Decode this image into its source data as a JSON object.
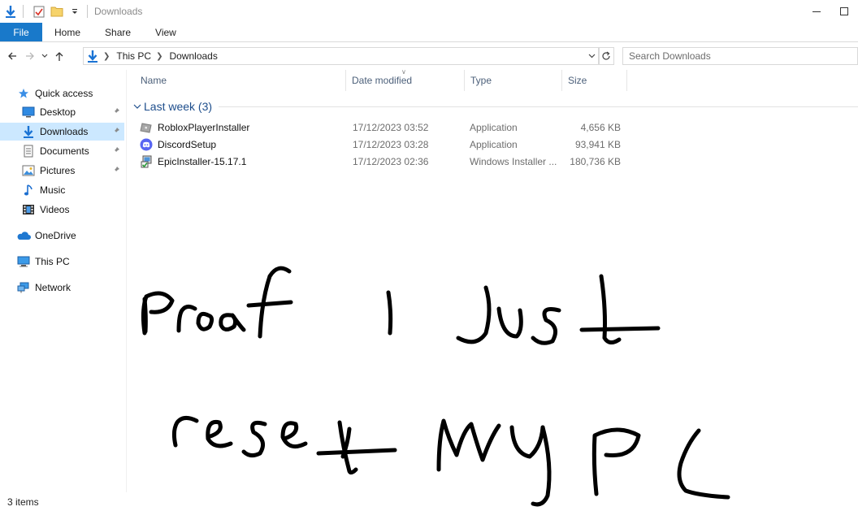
{
  "titlebar": {
    "title": "Downloads",
    "quick_access_icons": [
      "download-arrow-icon",
      "properties-icon",
      "new-folder-icon",
      "customize-dropdown-icon"
    ]
  },
  "ribbon": {
    "file": "File",
    "tabs": [
      "Home",
      "Share",
      "View"
    ]
  },
  "address": {
    "crumbs": [
      "This PC",
      "Downloads"
    ]
  },
  "search": {
    "placeholder": "Search Downloads"
  },
  "sidebar": {
    "quick_access": "Quick access",
    "items": [
      {
        "label": "Desktop",
        "icon": "desktop-icon",
        "pinned": true
      },
      {
        "label": "Downloads",
        "icon": "downloads-icon",
        "pinned": true,
        "selected": true
      },
      {
        "label": "Documents",
        "icon": "documents-icon",
        "pinned": true
      },
      {
        "label": "Pictures",
        "icon": "pictures-icon",
        "pinned": true
      },
      {
        "label": "Music",
        "icon": "music-icon",
        "pinned": false
      },
      {
        "label": "Videos",
        "icon": "videos-icon",
        "pinned": false
      }
    ],
    "onedrive": "OneDrive",
    "this_pc": "This PC",
    "network": "Network"
  },
  "columns": {
    "name": "Name",
    "date": "Date modified",
    "type": "Type",
    "size": "Size"
  },
  "group": {
    "label": "Last week (3)"
  },
  "files": [
    {
      "name": "RobloxPlayerInstaller",
      "date": "17/12/2023 03:52",
      "type": "Application",
      "size": "4,656 KB",
      "icon": "roblox-installer-icon"
    },
    {
      "name": "DiscordSetup",
      "date": "17/12/2023 03:28",
      "type": "Application",
      "size": "93,941 KB",
      "icon": "discord-icon"
    },
    {
      "name": "EpicInstaller-15.17.1",
      "date": "17/12/2023 02:36",
      "type": "Windows Installer ...",
      "size": "180,736 KB",
      "icon": "windows-installer-icon"
    }
  ],
  "scribble": {
    "text": "proof I just reset my PC",
    "color": "#000000"
  },
  "status": {
    "items": "3 items"
  },
  "colors": {
    "accent": "#1979ca",
    "selection": "#cce8ff",
    "group_header": "#1e4e8c",
    "column_header": "#4c607a"
  }
}
